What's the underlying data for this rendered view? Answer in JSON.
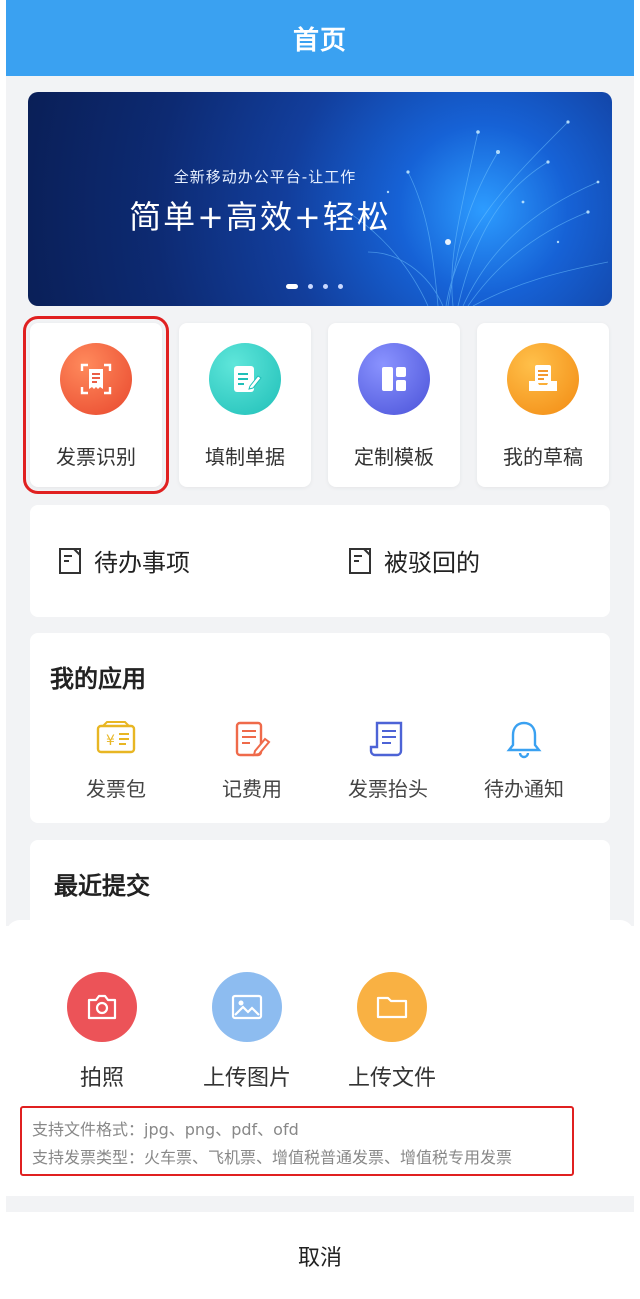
{
  "header": {
    "title": "首页"
  },
  "banner": {
    "subtitle": "全新移动办公平台-让工作",
    "headline": "简单+高效+轻松",
    "dots": 4,
    "active_dot": 1
  },
  "quick_actions": [
    {
      "label": "发票识别",
      "icon": "invoice-scan-icon",
      "color": "#ec5a3a",
      "highlighted": true
    },
    {
      "label": "填制单据",
      "icon": "edit-document-icon",
      "color": "#2ac9c1",
      "highlighted": false
    },
    {
      "label": "定制模板",
      "icon": "template-layout-icon",
      "color": "#5b63e8",
      "highlighted": false
    },
    {
      "label": "我的草稿",
      "icon": "draft-tray-icon",
      "color": "#f79a1e",
      "highlighted": false
    }
  ],
  "todo": {
    "pending_label": "待办事项",
    "rejected_label": "被驳回的"
  },
  "apps": {
    "title": "我的应用",
    "items": [
      {
        "label": "发票包",
        "icon": "invoice-bag-icon",
        "color": "#e8b623"
      },
      {
        "label": "记费用",
        "icon": "expense-note-icon",
        "color": "#ef6a4a"
      },
      {
        "label": "发票抬头",
        "icon": "invoice-title-icon",
        "color": "#4d63d6"
      },
      {
        "label": "待办通知",
        "icon": "bell-icon",
        "color": "#3aa1f1"
      }
    ]
  },
  "recent": {
    "title": "最近提交"
  },
  "sheet": {
    "options": [
      {
        "label": "拍照",
        "icon": "camera-icon",
        "color": "#ec5358"
      },
      {
        "label": "上传图片",
        "icon": "image-icon",
        "color": "#7fb5ee"
      },
      {
        "label": "上传文件",
        "icon": "folder-icon",
        "color": "#f9b143"
      }
    ],
    "formats": "支持文件格式：jpg、png、pdf、ofd",
    "types": "支持发票类型：火车票、飞机票、增值税普通发票、增值税专用发票",
    "cancel": "取消"
  }
}
